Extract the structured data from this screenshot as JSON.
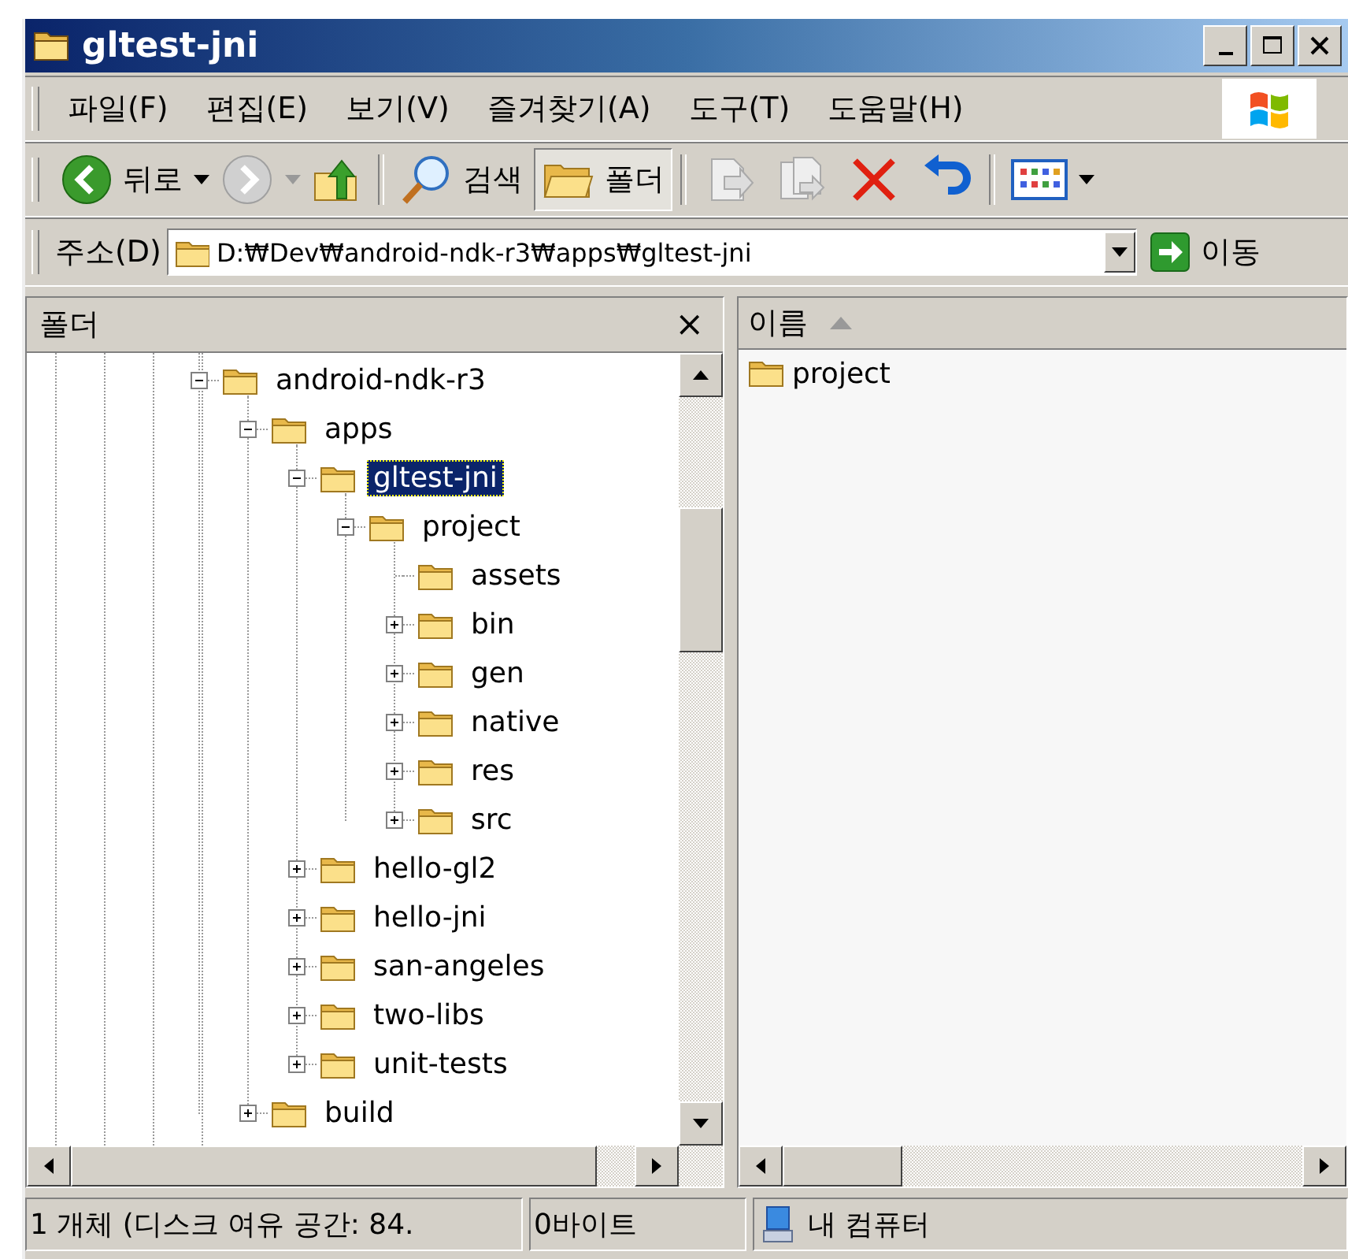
{
  "window": {
    "title": "gltest-jni"
  },
  "menu": [
    {
      "label": "파일(F)"
    },
    {
      "label": "편집(E)"
    },
    {
      "label": "보기(V)"
    },
    {
      "label": "즐겨찾기(A)"
    },
    {
      "label": "도구(T)"
    },
    {
      "label": "도움말(H)"
    }
  ],
  "toolbar": [
    {
      "kind": "back",
      "label": "뒤로",
      "disabled": false,
      "pressed": false
    },
    {
      "kind": "forward",
      "disabled": true,
      "pressed": false
    },
    {
      "kind": "up",
      "disabled": false,
      "pressed": false
    },
    {
      "kind": "search",
      "label": "검색",
      "disabled": false,
      "pressed": false
    },
    {
      "kind": "folders",
      "label": "폴더",
      "disabled": false,
      "pressed": true
    },
    {
      "kind": "move",
      "disabled": true,
      "pressed": false
    },
    {
      "kind": "copy",
      "disabled": true,
      "pressed": false
    },
    {
      "kind": "delete",
      "disabled": false,
      "pressed": false
    },
    {
      "kind": "undo",
      "disabled": false,
      "pressed": false
    },
    {
      "kind": "views",
      "disabled": false,
      "pressed": false
    }
  ],
  "address": {
    "label": "주소(D)",
    "value": "D:₩Dev₩android-ndk-r3₩apps₩gltest-jni",
    "go": "이동"
  },
  "folders_pane": {
    "title": "폴더",
    "close": "×",
    "tree": [
      {
        "name": "android-ndk-r3",
        "kind": "expanded",
        "selected": false,
        "children": [
          {
            "name": "apps",
            "kind": "expanded",
            "selected": false,
            "children": [
              {
                "name": "gltest-jni",
                "kind": "expanded",
                "selected": true,
                "children": [
                  {
                    "name": "project",
                    "kind": "expanded",
                    "selected": false,
                    "children": [
                      {
                        "name": "assets",
                        "kind": "leaf",
                        "selected": false
                      },
                      {
                        "name": "bin",
                        "kind": "collapsed",
                        "selected": false
                      },
                      {
                        "name": "gen",
                        "kind": "collapsed",
                        "selected": false
                      },
                      {
                        "name": "native",
                        "kind": "collapsed",
                        "selected": false
                      },
                      {
                        "name": "res",
                        "kind": "collapsed",
                        "selected": false
                      },
                      {
                        "name": "src",
                        "kind": "collapsed",
                        "selected": false
                      }
                    ]
                  }
                ]
              },
              {
                "name": "hello-gl2",
                "kind": "collapsed",
                "selected": false
              },
              {
                "name": "hello-jni",
                "kind": "collapsed",
                "selected": false
              },
              {
                "name": "san-angeles",
                "kind": "collapsed",
                "selected": false
              },
              {
                "name": "two-libs",
                "kind": "collapsed",
                "selected": false
              },
              {
                "name": "unit-tests",
                "kind": "collapsed",
                "selected": false
              }
            ]
          },
          {
            "name": "build",
            "kind": "collapsed",
            "selected": false
          }
        ]
      }
    ]
  },
  "files_pane": {
    "columns": [
      {
        "label": "이름",
        "sorted": true
      }
    ],
    "items": [
      {
        "name": "project"
      }
    ]
  },
  "status_bar": {
    "summary": "1 개체 (디스크 여유 공간: 84.",
    "size": "0바이트",
    "zone": "내 컴퓨터"
  }
}
